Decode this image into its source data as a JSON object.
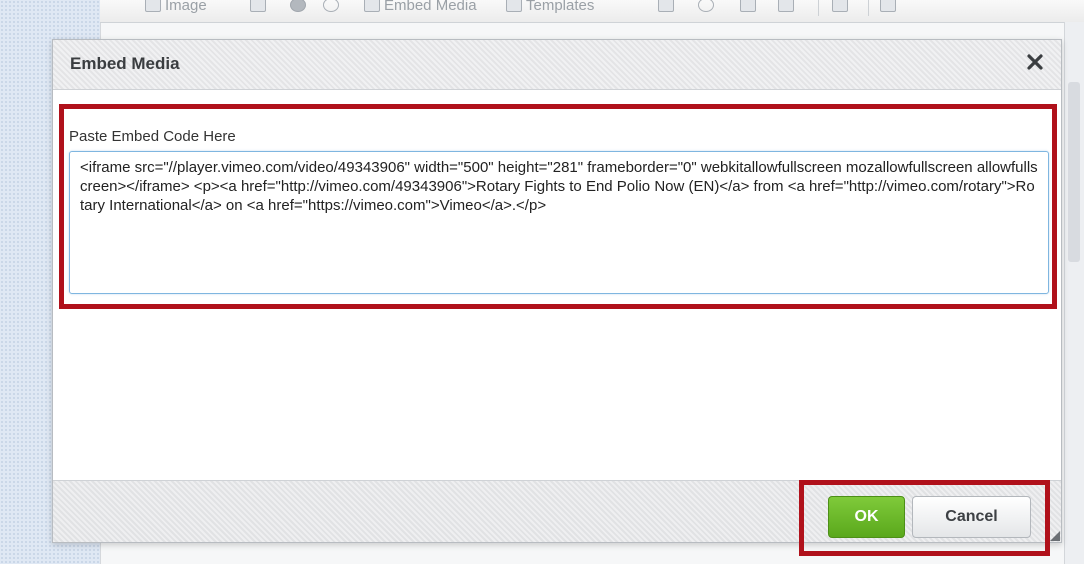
{
  "toolbar": {
    "image_label": "Image",
    "embed_media_label": "Embed Media",
    "templates_label": "Templates"
  },
  "dialog": {
    "title": "Embed Media",
    "close_glyph": "✕",
    "field_label": "Paste Embed Code Here",
    "embed_code": "<iframe src=\"//player.vimeo.com/video/49343906\" width=\"500\" height=\"281\" frameborder=\"0\" webkitallowfullscreen mozallowfullscreen allowfullscreen></iframe> <p><a href=\"http://vimeo.com/49343906\">Rotary Fights to End Polio Now (EN)</a> from <a href=\"http://vimeo.com/rotary\">Rotary International</a> on <a href=\"https://vimeo.com\">Vimeo</a>.</p>",
    "ok_label": "OK",
    "cancel_label": "Cancel"
  },
  "colors": {
    "highlight": "#b0111b",
    "ok_button": "#6cb82a",
    "textarea_focus": "#7fb6e0"
  }
}
